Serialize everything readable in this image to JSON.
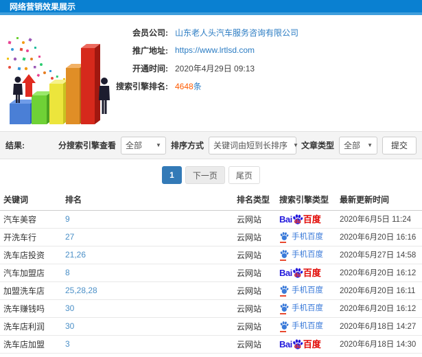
{
  "header": {
    "title": "网络营销效果展示"
  },
  "info": {
    "company_label": "会员公司:",
    "company_value": "山东老人头汽车服务咨询有限公司",
    "url_label": "推广地址:",
    "url_value": "https://www.lrtlsd.com",
    "open_label": "开通时间:",
    "open_value": "2020年4月29日 09:13",
    "rank_label": "搜索引擎排名:",
    "rank_count": "4648",
    "rank_unit": "条"
  },
  "filters": {
    "result_label": "结果:",
    "engine_label": "分搜索引擎查看",
    "engine_value": "全部",
    "sort_label": "排序方式",
    "sort_value": "关键词由短到长排序",
    "article_label": "文章类型",
    "article_value": "全部",
    "submit_label": "提交",
    "caret": "▼"
  },
  "pagination": {
    "current": "1",
    "next": "下一页",
    "last": "尾页"
  },
  "engine_logo": {
    "bai": "Bai",
    "du": "du",
    "cn": "百度",
    "mobile_text": "手机百度",
    "baidu_blue": "#2319dc",
    "baidu_red": "#e10601",
    "mobile_blue": "#3a7ad9"
  },
  "table": {
    "headers": [
      "关键词",
      "排名",
      "排名类型",
      "搜索引擎类型",
      "最新更新时间"
    ],
    "rows": [
      {
        "keyword": "汽车美容",
        "rank": "9",
        "rank_type": "云网站",
        "engine": "baidu",
        "updated": "2020年6月5日 11:24"
      },
      {
        "keyword": "开洗车行",
        "rank": "27",
        "rank_type": "云网站",
        "engine": "mobile-baidu",
        "updated": "2020年6月20日 16:16"
      },
      {
        "keyword": "洗车店投资",
        "rank": "21,26",
        "rank_type": "云网站",
        "engine": "mobile-baidu",
        "updated": "2020年5月27日 14:58"
      },
      {
        "keyword": "汽车加盟店",
        "rank": "8",
        "rank_type": "云网站",
        "engine": "baidu",
        "updated": "2020年6月20日 16:12"
      },
      {
        "keyword": "加盟洗车店",
        "rank": "25,28,28",
        "rank_type": "云网站",
        "engine": "mobile-baidu",
        "updated": "2020年6月20日 16:11"
      },
      {
        "keyword": "洗车赚钱吗",
        "rank": "30",
        "rank_type": "云网站",
        "engine": "mobile-baidu",
        "updated": "2020年6月20日 16:12"
      },
      {
        "keyword": "洗车店利润",
        "rank": "30",
        "rank_type": "云网站",
        "engine": "mobile-baidu",
        "updated": "2020年6月18日 14:27"
      },
      {
        "keyword": "洗车店加盟",
        "rank": "3",
        "rank_type": "云网站",
        "engine": "baidu",
        "updated": "2020年6月18日 14:30"
      }
    ]
  }
}
